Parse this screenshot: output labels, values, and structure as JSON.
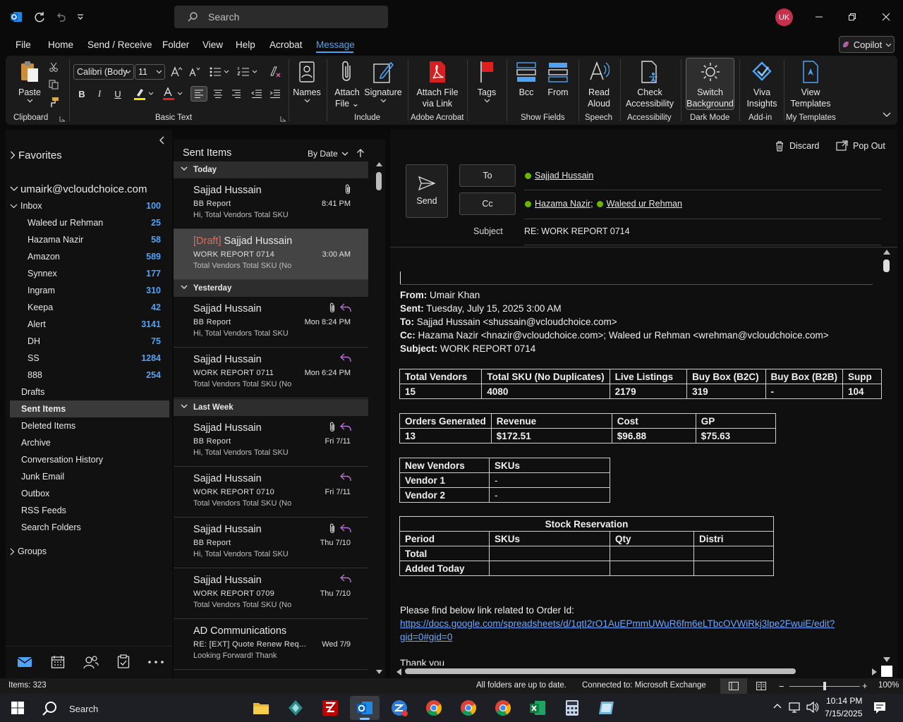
{
  "titlebar": {
    "search_placeholder": "Search",
    "avatar_initials": "UK"
  },
  "menu": [
    "File",
    "Home",
    "Send / Receive",
    "Folder",
    "View",
    "Help",
    "Acrobat",
    "Message"
  ],
  "copilot_label": "Copilot",
  "ribbon": {
    "paste": "Paste",
    "font_name": "Calibri (Body",
    "font_size": "11",
    "names": "Names",
    "attach_file": [
      "Attach",
      "File ⌄"
    ],
    "signature": "Signature",
    "attach_link": [
      "Attach File",
      "via Link"
    ],
    "tags": "Tags",
    "bcc": "Bcc",
    "from": "From",
    "read_aloud": [
      "Read",
      "Aloud"
    ],
    "check_access": [
      "Check",
      "Accessibility"
    ],
    "switch_bg": [
      "Switch",
      "Background"
    ],
    "viva": [
      "Viva",
      "Insights"
    ],
    "view_templates": [
      "View",
      "Templates"
    ],
    "groups": {
      "clipboard": "Clipboard",
      "basic_text": "Basic Text",
      "include": "Include",
      "adobe": "Adobe Acrobat",
      "show_fields": "Show Fields",
      "speech": "Speech",
      "accessibility": "Accessibility",
      "dark_mode": "Dark Mode",
      "addin": "Add-in",
      "my_templates": "My Templates"
    }
  },
  "nav": {
    "favorites": "Favorites",
    "account": "umairk@vcloudchoice.com",
    "inbox": {
      "label": "Inbox",
      "count": "100"
    },
    "inbox_children": [
      {
        "label": "Waleed ur Rehman",
        "count": "25"
      },
      {
        "label": "Hazama Nazir",
        "count": "58"
      },
      {
        "label": "Amazon",
        "count": "589"
      },
      {
        "label": "Synnex",
        "count": "177"
      },
      {
        "label": "Ingram",
        "count": "310"
      },
      {
        "label": "Keepa",
        "count": "42"
      },
      {
        "label": "Alert",
        "count": "3141"
      },
      {
        "label": "DH",
        "count": "75"
      },
      {
        "label": "SS",
        "count": "1284"
      },
      {
        "label": "888",
        "count": "254"
      }
    ],
    "folders": [
      "Drafts",
      "Sent Items",
      "Deleted Items",
      "Archive",
      "Conversation History",
      "Junk Email",
      "Outbox",
      "RSS Feeds",
      "Search Folders"
    ],
    "groups": "Groups"
  },
  "list": {
    "title": "Sent Items",
    "sort": "By Date",
    "groups": [
      "Today",
      "Yesterday",
      "Last Week"
    ],
    "messages": [
      {
        "draft": "",
        "sender": "Sajjad Hussain",
        "subject": "BB Report",
        "preview": "Hi,  Total Vendors  Total SKU",
        "time": "8:41 PM"
      },
      {
        "draft": "[Draft] ",
        "sender": "Sajjad Hussain",
        "subject": "WORK REPORT 0714",
        "preview": "Total Vendors  Total SKU (No",
        "time": "3:00 AM"
      },
      {
        "draft": "",
        "sender": "Sajjad Hussain",
        "subject": "BB Report",
        "preview": "Hi,  Total Vendors  Total SKU",
        "time": "Mon 8:24 PM"
      },
      {
        "draft": "",
        "sender": "Sajjad Hussain",
        "subject": "WORK REPORT 0711",
        "preview": "Total Vendors  Total SKU (No",
        "time": "Mon 6:24 PM"
      },
      {
        "draft": "",
        "sender": "Sajjad Hussain",
        "subject": "BB Report",
        "preview": "Hi,  Total Vendors  Total SKU",
        "time": "Fri 7/11"
      },
      {
        "draft": "",
        "sender": "Sajjad Hussain",
        "subject": "WORK REPORT 0710",
        "preview": "Total Vendors  Total SKU (No",
        "time": "Fri 7/11"
      },
      {
        "draft": "",
        "sender": "Sajjad Hussain",
        "subject": "BB Report",
        "preview": "Hi,  Total Vendors  Total SKU",
        "time": "Thu 7/10"
      },
      {
        "draft": "",
        "sender": "Sajjad Hussain",
        "subject": "WORK REPORT 0709",
        "preview": "Total Vendors  Total SKU (No",
        "time": "Thu 7/10"
      },
      {
        "draft": "",
        "sender": "AD Communications",
        "subject": "RE: [EXT] Quote Renew Req...",
        "preview": "Looking Forward!  Thank",
        "time": "Wed 7/9"
      }
    ]
  },
  "compose": {
    "discard": "Discard",
    "popout": "Pop Out",
    "send": "Send",
    "to_btn": "To",
    "cc_btn": "Cc",
    "to": "Sajjad Hussain",
    "cc1": "Hazama Nazir;",
    "cc2": "Waleed ur Rehman",
    "subject_label": "Subject",
    "subject": "RE: WORK REPORT 0714"
  },
  "email": {
    "from_label": "From:",
    "from": " Umair Khan",
    "sent_label": "Sent:",
    "sent": " Tuesday, July 15, 2025 3:00 AM",
    "to_label": "To:",
    "to": " Sajjad Hussain <shussain@vcloudchoice.com>",
    "cc_label": "Cc:",
    "cc": " Hazama Nazir <hnazir@vcloudchoice.com>; Waleed ur Rehman <wrehman@vcloudchoice.com>",
    "subject_label": "Subject:",
    "subject": " WORK REPORT 0714",
    "table1": {
      "headers": [
        "Total Vendors",
        "Total SKU (No Duplicates)",
        "Live Listings",
        "Buy Box (B2C)",
        "Buy Box (B2B)",
        "Supp"
      ],
      "values": [
        "15",
        "4080",
        "2179",
        "319",
        "-",
        "104"
      ]
    },
    "table2": {
      "headers": [
        "Orders Generated",
        "Revenue",
        "Cost",
        "GP"
      ],
      "values": [
        "13",
        "$172.51",
        "$96.88",
        "$75.63"
      ]
    },
    "table3": {
      "headers": [
        "New Vendors",
        "SKUs"
      ],
      "rows": [
        [
          "Vendor 1",
          "-"
        ],
        [
          "Vendor 2",
          "-"
        ]
      ]
    },
    "table4": {
      "title": "Stock Reservation",
      "headers": [
        "Period",
        "SKUs",
        "Qty",
        "Distri"
      ],
      "rows": [
        "Total",
        "Added Today"
      ]
    },
    "link_intro": "Please find below link related to Order Id:",
    "link_line1": "https://docs.google.com/spreadsheets/d/1qtI2rO1AuEPmmUWuR6fm6eLTbcOVWiRkj3lpe2FwuiE/edit?",
    "link_line2": "gid=0#gid=0",
    "closing": "Thank you"
  },
  "status": {
    "items": "Items: 323",
    "sync": "All folders are up to date.",
    "connection": "Connected to: Microsoft Exchange",
    "zoom": "100%"
  },
  "taskbar": {
    "search": "Search",
    "time": "10:14 PM",
    "date": "7/15/2025"
  },
  "colors": {
    "accent": "#4fa3f7",
    "count": "#4fa3f7",
    "draft": "#e26b5f",
    "presence": "#6bb700",
    "avatar": "#c4314b"
  }
}
